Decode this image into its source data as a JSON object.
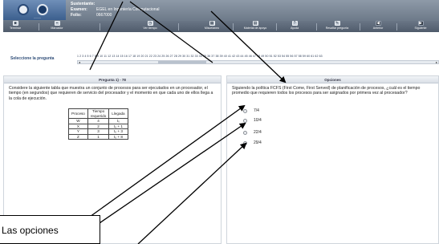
{
  "header": {
    "logo_caption": "———",
    "labels": {
      "sustentante": "Sustentante:",
      "examen": "Examen:",
      "folio": "Folio:"
    },
    "values": {
      "sustentante": "",
      "examen": "EGEL en Ingeniería Computacional",
      "folio": "0667000"
    }
  },
  "toolbar": {
    "buttons": [
      {
        "label": "Terminar",
        "icon": "stop-icon"
      },
      {
        "label": "Marcador",
        "icon": "bookmark-icon"
      },
      {
        "label": "Ver tiempo",
        "icon": "clock-icon"
      },
      {
        "label": "Misceláneo",
        "icon": "calculator-icon"
      },
      {
        "label": "Material de apoyo",
        "icon": "book-icon"
      },
      {
        "label": "Ayuda",
        "icon": "help-icon"
      },
      {
        "label": "Resaltar pregunta",
        "icon": "highlight-icon"
      },
      {
        "label": "Anterior",
        "icon": "previous-icon"
      },
      {
        "label": "Siguiente",
        "icon": "next-icon"
      }
    ]
  },
  "selector": {
    "label": "Seleccione la pregunta",
    "numbers": "1 2 3 4 5 6 7 8 9 10 11 12 13 14 15 16 17 18 19 20 21 22 23 24 25 26 27 28 29 30 31 32 33 34 35 36 37 38 39 40 41 42 43 44 45 46 47 48 49 50 51 52 53 54 55 56 57 58 59 60 61 62 63"
  },
  "question": {
    "header": "Pregunta 1) - 78",
    "text": "Considere la siguiente tabla que muestra un conjunto de procesos para ser ejecutados en un procesador, el tiempo (en segundos) que requieren de servicio del procesador y el momento en que cada uno de ellos llega a la cola de ejecución.",
    "table": {
      "headers": [
        "Proceso",
        "Tiempo requerido",
        "Llegada"
      ],
      "rows": [
        [
          "W",
          "4",
          "t₀"
        ],
        [
          "X",
          "2",
          "t₀ + 1"
        ],
        [
          "Y",
          "3",
          "t₀ + 3"
        ],
        [
          "Z",
          "1",
          "t₀ + 8"
        ]
      ]
    }
  },
  "options": {
    "header": "Opciones",
    "prompt": "Siguiendo la política FCFS (First Come, First Served) de planificación de procesos, ¿cuál es el tiempo promedio que requieren todos los procesos para ser asignados por primera vez al procesador?",
    "items": [
      "7/4",
      "10/4",
      "22/4",
      "29/4"
    ]
  },
  "annotation": {
    "callout": "Las opciones"
  }
}
